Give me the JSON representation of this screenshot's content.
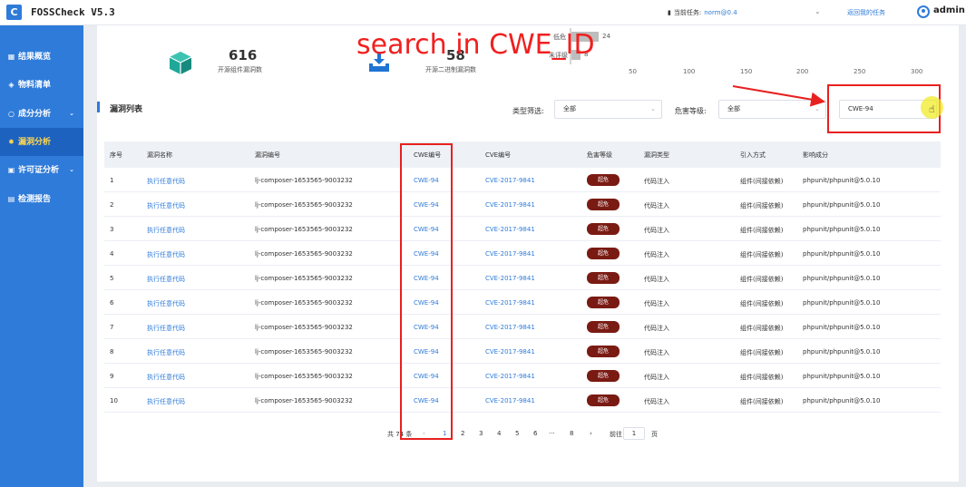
{
  "header": {
    "logo": "C",
    "app_title": "FOSSCheck V5.3",
    "task_label": "当前任务:",
    "task_value": "norm@0.4",
    "back_link": "返回我的任务",
    "user": "admin"
  },
  "sidebar": {
    "items": [
      {
        "label": "结果概览",
        "icon": "grid-icon"
      },
      {
        "label": "物料清单",
        "icon": "box-icon"
      },
      {
        "label": "成分分析",
        "icon": "circle-icon",
        "has_chevron": true
      },
      {
        "label": "漏洞分析",
        "icon": "bug-icon",
        "active": true
      },
      {
        "label": "许可证分析",
        "icon": "license-icon",
        "has_chevron": true
      },
      {
        "label": "检测报告",
        "icon": "report-icon"
      }
    ]
  },
  "stats": [
    {
      "value": "616",
      "label": "开源组件漏洞数"
    },
    {
      "value": "58",
      "label": "开源二进制漏洞数"
    }
  ],
  "mini_chart": {
    "categories": [
      "低危",
      "未评级"
    ],
    "values": [
      24,
      8
    ],
    "ticks": [
      "50",
      "100",
      "150",
      "200",
      "250",
      "300"
    ]
  },
  "section": {
    "title": "漏洞列表",
    "type_filter_label": "类型筛选:",
    "type_filter_value": "全部",
    "level_filter_label": "危害等级:",
    "level_filter_value": "全部",
    "search_value": "CWE-94"
  },
  "annotation": {
    "text": "search in CWE_ID",
    "color": "#f02020"
  },
  "table": {
    "headers": [
      "序号",
      "漏洞名称",
      "漏洞编号",
      "CWE编号",
      "CVE编号",
      "危害等级",
      "漏洞类型",
      "引入方式",
      "影响成分"
    ],
    "rows": [
      {
        "idx": "1",
        "name": "执行任意代码",
        "vid": "lj-composer-1653565-9003232",
        "cwe": "CWE-94",
        "cve": "CVE-2017-9841",
        "level": "超危",
        "type": "代码注入",
        "intro": "组件(间接依赖)",
        "component": "phpunit/phpunit@5.0.10"
      },
      {
        "idx": "2",
        "name": "执行任意代码",
        "vid": "lj-composer-1653565-9003232",
        "cwe": "CWE-94",
        "cve": "CVE-2017-9841",
        "level": "超危",
        "type": "代码注入",
        "intro": "组件(间接依赖)",
        "component": "phpunit/phpunit@5.0.10"
      },
      {
        "idx": "3",
        "name": "执行任意代码",
        "vid": "lj-composer-1653565-9003232",
        "cwe": "CWE-94",
        "cve": "CVE-2017-9841",
        "level": "超危",
        "type": "代码注入",
        "intro": "组件(间接依赖)",
        "component": "phpunit/phpunit@5.0.10"
      },
      {
        "idx": "4",
        "name": "执行任意代码",
        "vid": "lj-composer-1653565-9003232",
        "cwe": "CWE-94",
        "cve": "CVE-2017-9841",
        "level": "超危",
        "type": "代码注入",
        "intro": "组件(间接依赖)",
        "component": "phpunit/phpunit@5.0.10"
      },
      {
        "idx": "5",
        "name": "执行任意代码",
        "vid": "lj-composer-1653565-9003232",
        "cwe": "CWE-94",
        "cve": "CVE-2017-9841",
        "level": "超危",
        "type": "代码注入",
        "intro": "组件(间接依赖)",
        "component": "phpunit/phpunit@5.0.10"
      },
      {
        "idx": "6",
        "name": "执行任意代码",
        "vid": "lj-composer-1653565-9003232",
        "cwe": "CWE-94",
        "cve": "CVE-2017-9841",
        "level": "超危",
        "type": "代码注入",
        "intro": "组件(间接依赖)",
        "component": "phpunit/phpunit@5.0.10"
      },
      {
        "idx": "7",
        "name": "执行任意代码",
        "vid": "lj-composer-1653565-9003232",
        "cwe": "CWE-94",
        "cve": "CVE-2017-9841",
        "level": "超危",
        "type": "代码注入",
        "intro": "组件(间接依赖)",
        "component": "phpunit/phpunit@5.0.10"
      },
      {
        "idx": "8",
        "name": "执行任意代码",
        "vid": "lj-composer-1653565-9003232",
        "cwe": "CWE-94",
        "cve": "CVE-2017-9841",
        "level": "超危",
        "type": "代码注入",
        "intro": "组件(间接依赖)",
        "component": "phpunit/phpunit@5.0.10"
      },
      {
        "idx": "9",
        "name": "执行任意代码",
        "vid": "lj-composer-1653565-9003232",
        "cwe": "CWE-94",
        "cve": "CVE-2017-9841",
        "level": "超危",
        "type": "代码注入",
        "intro": "组件(间接依赖)",
        "component": "phpunit/phpunit@5.0.10"
      },
      {
        "idx": "10",
        "name": "执行任意代码",
        "vid": "lj-composer-1653565-9003232",
        "cwe": "CWE-94",
        "cve": "CVE-2017-9841",
        "level": "超危",
        "type": "代码注入",
        "intro": "组件(间接依赖)",
        "component": "phpunit/phpunit@5.0.10"
      }
    ]
  },
  "pagination": {
    "total": "共 74 条",
    "prev": "‹",
    "pages": [
      "1",
      "2",
      "3",
      "4",
      "5",
      "6",
      "···",
      "8"
    ],
    "current": "1",
    "next": "›",
    "goto_label": "前往",
    "goto_value": "1",
    "goto_suffix": "页"
  },
  "colors": {
    "brand": "#2f7bd9",
    "sidebar_active": "#1e62c0",
    "badge": "#7a1b13",
    "annotation": "#e82020"
  }
}
